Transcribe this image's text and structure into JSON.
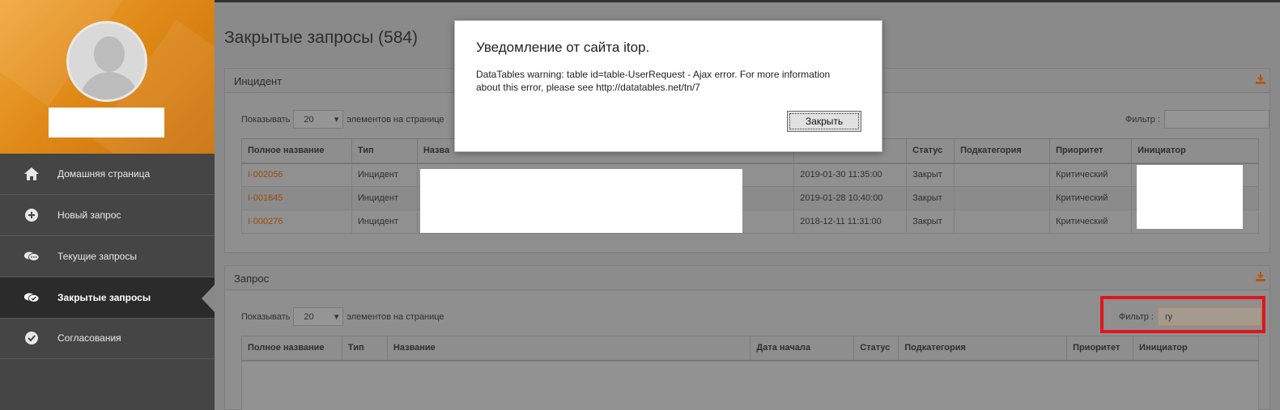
{
  "sidebar": {
    "nav": [
      {
        "label": "Домашняя страница",
        "icon": "home-icon",
        "active": false
      },
      {
        "label": "Новый запрос",
        "icon": "plus-circle-icon",
        "active": false
      },
      {
        "label": "Текущие запросы",
        "icon": "chat-bubbles-icon",
        "active": false
      },
      {
        "label": "Закрытые запросы",
        "icon": "closed-chat-icon",
        "active": true
      },
      {
        "label": "Согласования",
        "icon": "check-circle-icon",
        "active": false
      }
    ]
  },
  "page": {
    "title": "Закрытые запросы (584)"
  },
  "incident_panel": {
    "title": "Инцидент",
    "pager": {
      "show_label": "Показывать",
      "page_size": "20",
      "per_page_label": "элементов на странице"
    },
    "filter": {
      "label": "Фильтр :",
      "value": ""
    },
    "columns": [
      "Полное название",
      "Тип",
      "Назва",
      "",
      "Статус",
      "Подкатегория",
      "Приоритет",
      "Инициатор"
    ],
    "rows": [
      {
        "id": "I-002056",
        "type": "Инцидент",
        "date": "2019-01-30 11:35:00",
        "status": "Закрыт",
        "subcategory": "",
        "priority": "Критический"
      },
      {
        "id": "I-001845",
        "type": "Инцидент",
        "date": "2019-01-28 10:40:00",
        "status": "Закрыт",
        "subcategory": "",
        "priority": "Критический"
      },
      {
        "id": "I-000276",
        "type": "Инцидент",
        "date": "2018-12-11 11:31:00",
        "status": "Закрыт",
        "subcategory": "",
        "priority": "Критический"
      }
    ]
  },
  "request_panel": {
    "title": "Запрос",
    "pager": {
      "show_label": "Показывать",
      "page_size": "20",
      "per_page_label": "элементов на странице"
    },
    "filter": {
      "label": "Фильтр :",
      "value": "ry"
    },
    "columns": [
      "Полное название",
      "Тип",
      "Название",
      "Дата начала",
      "Статус",
      "Подкатегория",
      "Приоритет",
      "Инициатор"
    ]
  },
  "modal": {
    "title": "Уведомление от сайта itop.",
    "message": "DataTables warning: table id=table-UserRequest - Ajax error. For more information about this error, please see http://datatables.net/tn/7",
    "close_label": "Закрыть"
  },
  "colors": {
    "accent": "#e08a18",
    "highlight": "#e0151d",
    "link": "#9a4a12"
  }
}
